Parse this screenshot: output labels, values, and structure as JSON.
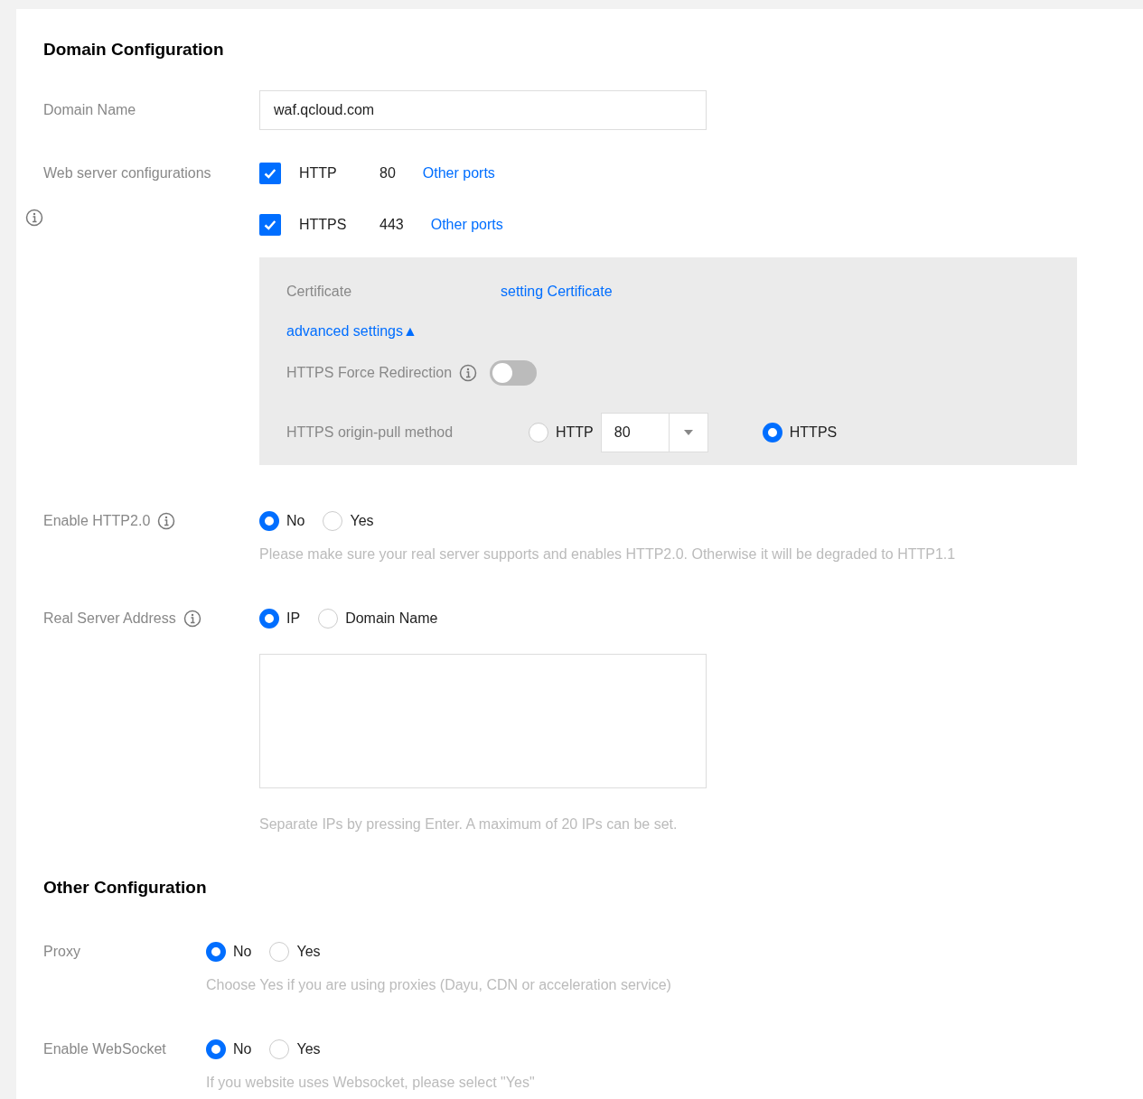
{
  "sections": [
    {
      "title": "Domain Configuration",
      "kind": "wide",
      "fields": [
        {
          "kind": "text",
          "label": "Domain Name",
          "value": "waf.qcloud.com"
        },
        {
          "kind": "protocols",
          "label": "Web server configurations",
          "protocols": [
            {
              "label": "HTTP",
              "port": "80",
              "link": "Other ports",
              "checked": true
            },
            {
              "label": "HTTPS",
              "port": "443",
              "link": "Other ports",
              "checked": true
            }
          ],
          "https_panel": {
            "certificate_label": "Certificate",
            "certificate_link": "setting Certificate",
            "advanced_link": "advanced settings▲",
            "force_redirect": {
              "label": "HTTPS Force Redirection",
              "on": false
            },
            "origin_pull": {
              "label": "HTTPS origin-pull method",
              "options": [
                {
                  "label": "HTTP",
                  "selected": false
                },
                {
                  "label": "HTTPS",
                  "selected": true
                }
              ],
              "port": "80"
            }
          }
        },
        {
          "kind": "radio_info",
          "label": "Enable HTTP2.0",
          "options": [
            {
              "label": "No",
              "selected": true
            },
            {
              "label": "Yes",
              "selected": false
            }
          ],
          "hint": "Please make sure your real server supports and enables HTTP2.0. Otherwise it will be degraded to HTTP1.1"
        },
        {
          "kind": "address",
          "label": "Real Server Address",
          "options": [
            {
              "label": "IP",
              "selected": true
            },
            {
              "label": "Domain Name",
              "selected": false
            }
          ],
          "hint": "Separate IPs by pressing Enter. A maximum of 20 IPs can be set."
        }
      ]
    },
    {
      "title": "Other Configuration",
      "kind": "narrow",
      "fields": [
        {
          "kind": "radio",
          "label": "Proxy",
          "options": [
            {
              "label": "No",
              "selected": true
            },
            {
              "label": "Yes",
              "selected": false
            }
          ],
          "hint": "Choose Yes if you are using proxies (Dayu, CDN or acceleration service)"
        },
        {
          "kind": "radio",
          "label": "Enable WebSocket",
          "options": [
            {
              "label": "No",
              "selected": true
            },
            {
              "label": "Yes",
              "selected": false
            }
          ],
          "hint": "If you website uses Websocket, please select \"Yes\""
        }
      ]
    }
  ]
}
